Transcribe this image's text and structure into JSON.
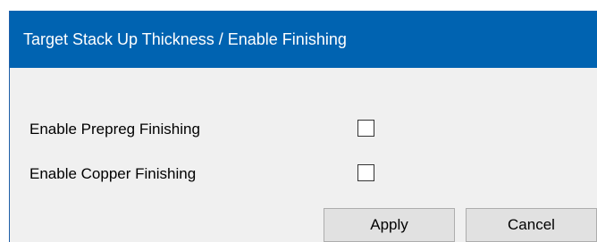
{
  "dialog": {
    "title": "Target Stack Up Thickness / Enable Finishing",
    "options": [
      {
        "label": "Enable Prepreg Finishing",
        "checked": false
      },
      {
        "label": "Enable Copper Finishing",
        "checked": false
      }
    ],
    "apply_label": "Apply",
    "cancel_label": "Cancel"
  },
  "colors": {
    "titlebar": "#0063b1",
    "dialog_background": "#f0f0f0",
    "button_background": "#e1e1e1"
  }
}
